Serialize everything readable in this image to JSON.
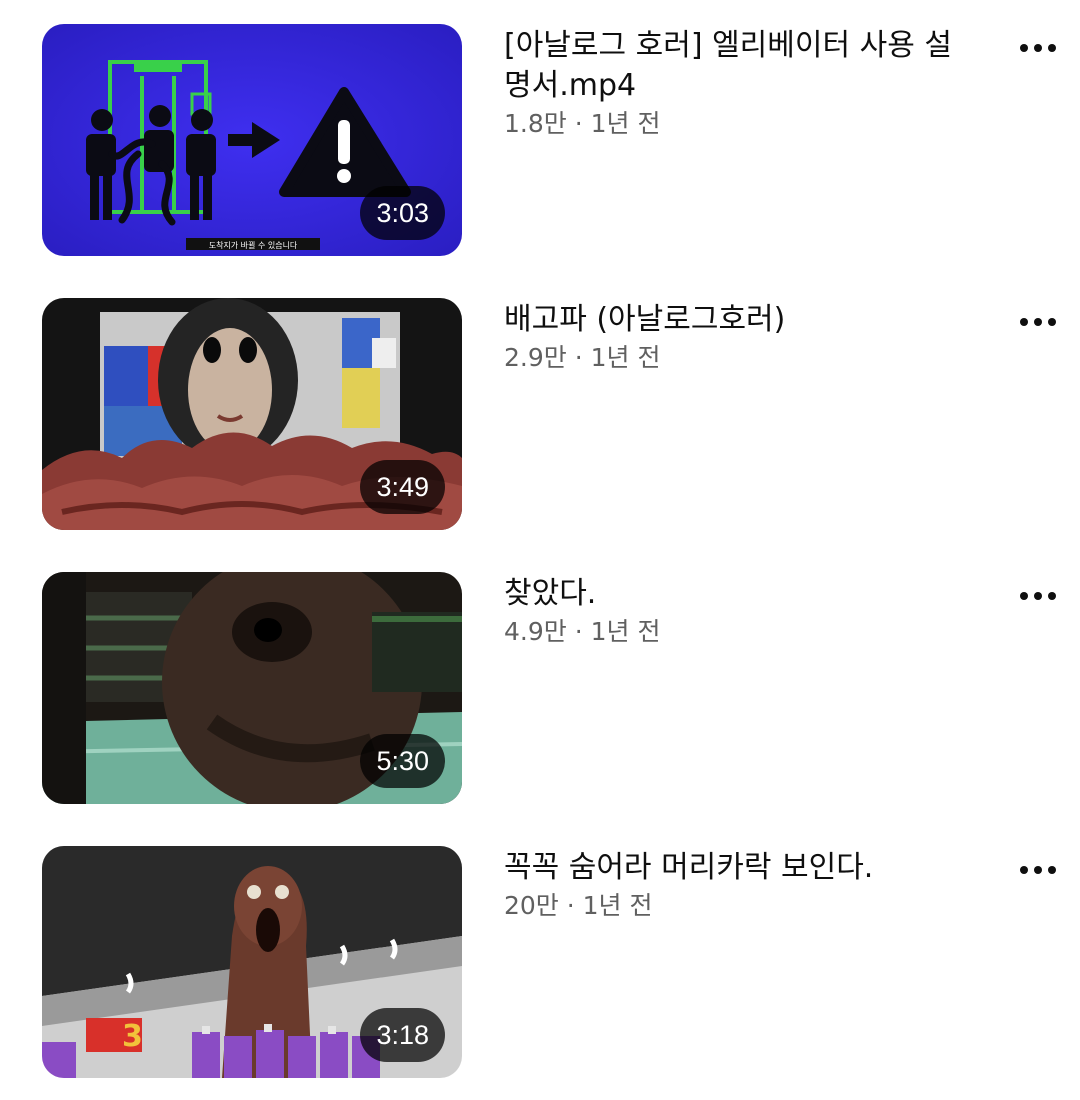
{
  "videos": [
    {
      "title": "[아날로그 호러] 엘리베이터 사용 설명서.mp4",
      "meta": "1.8만 · 1년 전",
      "duration": "3:03",
      "thumb_caption": "도착지가 바뀔 수 있습니다"
    },
    {
      "title": "배고파 (아날로그호러)",
      "meta": "2.9만 · 1년 전",
      "duration": "3:49"
    },
    {
      "title": "찾았다.",
      "meta": "4.9만 · 1년 전",
      "duration": "5:30"
    },
    {
      "title": "꼭꼭 숨어라 머리카락 보인다.",
      "meta": "20만 · 1년 전",
      "duration": "3:18",
      "thumb_sign": "3"
    }
  ],
  "icons": {
    "more": "more-vert-icon"
  }
}
